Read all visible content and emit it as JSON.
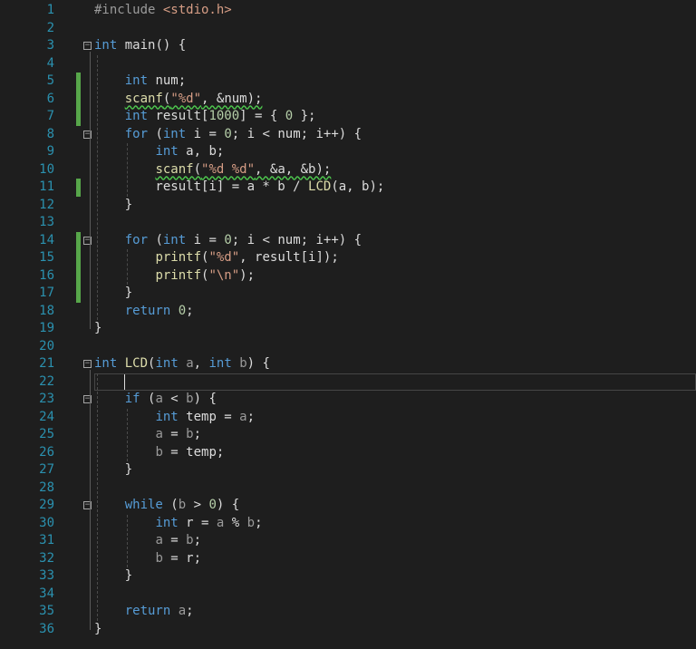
{
  "editor": {
    "lines": [
      {
        "n": "1",
        "tokens": [
          [
            "pp",
            "#include "
          ],
          [
            "str",
            "<stdio.h>"
          ]
        ]
      },
      {
        "n": "2",
        "tokens": []
      },
      {
        "n": "3",
        "tokens": [
          [
            "kw",
            "int"
          ],
          [
            "plain",
            " main() {"
          ]
        ]
      },
      {
        "n": "4",
        "tokens": []
      },
      {
        "n": "5",
        "tokens": [
          [
            "plain",
            "    "
          ],
          [
            "kw",
            "int"
          ],
          [
            "plain",
            " num;"
          ]
        ]
      },
      {
        "n": "6",
        "tokens": [
          [
            "plain",
            "    "
          ],
          [
            "fn",
            "scanf"
          ],
          [
            "plain",
            "("
          ],
          [
            "str",
            "\"%d\""
          ],
          [
            "plain",
            ", &num);"
          ]
        ]
      },
      {
        "n": "7",
        "tokens": [
          [
            "plain",
            "    "
          ],
          [
            "kw",
            "int"
          ],
          [
            "plain",
            " result["
          ],
          [
            "num",
            "1000"
          ],
          [
            "plain",
            "] = { "
          ],
          [
            "num",
            "0"
          ],
          [
            "plain",
            " };"
          ]
        ]
      },
      {
        "n": "8",
        "tokens": [
          [
            "plain",
            "    "
          ],
          [
            "kw",
            "for"
          ],
          [
            "plain",
            " ("
          ],
          [
            "kw",
            "int"
          ],
          [
            "plain",
            " i = "
          ],
          [
            "num",
            "0"
          ],
          [
            "plain",
            "; i < num; i++) {"
          ]
        ]
      },
      {
        "n": "9",
        "tokens": [
          [
            "plain",
            "        "
          ],
          [
            "kw",
            "int"
          ],
          [
            "plain",
            " a, b;"
          ]
        ]
      },
      {
        "n": "10",
        "tokens": [
          [
            "plain",
            "        "
          ],
          [
            "fn",
            "scanf"
          ],
          [
            "plain",
            "("
          ],
          [
            "str",
            "\"%d %d\""
          ],
          [
            "plain",
            ", &a, &b);"
          ]
        ]
      },
      {
        "n": "11",
        "tokens": [
          [
            "plain",
            "        result[i] = a * b / "
          ],
          [
            "fn",
            "LCD"
          ],
          [
            "plain",
            "(a, b);"
          ]
        ]
      },
      {
        "n": "12",
        "tokens": [
          [
            "plain",
            "    }"
          ]
        ]
      },
      {
        "n": "13",
        "tokens": []
      },
      {
        "n": "14",
        "tokens": [
          [
            "plain",
            "    "
          ],
          [
            "kw",
            "for"
          ],
          [
            "plain",
            " ("
          ],
          [
            "kw",
            "int"
          ],
          [
            "plain",
            " i = "
          ],
          [
            "num",
            "0"
          ],
          [
            "plain",
            "; i < num; i++) {"
          ]
        ]
      },
      {
        "n": "15",
        "tokens": [
          [
            "plain",
            "        "
          ],
          [
            "fn",
            "printf"
          ],
          [
            "plain",
            "("
          ],
          [
            "str",
            "\"%d\""
          ],
          [
            "plain",
            ", result[i]);"
          ]
        ]
      },
      {
        "n": "16",
        "tokens": [
          [
            "plain",
            "        "
          ],
          [
            "fn",
            "printf"
          ],
          [
            "plain",
            "("
          ],
          [
            "str",
            "\"\\n\""
          ],
          [
            "plain",
            ");"
          ]
        ]
      },
      {
        "n": "17",
        "tokens": [
          [
            "plain",
            "    }"
          ]
        ]
      },
      {
        "n": "18",
        "tokens": [
          [
            "plain",
            "    "
          ],
          [
            "kw",
            "return"
          ],
          [
            "plain",
            " "
          ],
          [
            "num",
            "0"
          ],
          [
            "plain",
            ";"
          ]
        ]
      },
      {
        "n": "19",
        "tokens": [
          [
            "plain",
            "}"
          ]
        ]
      },
      {
        "n": "20",
        "tokens": []
      },
      {
        "n": "21",
        "tokens": [
          [
            "kw",
            "int"
          ],
          [
            "plain",
            " "
          ],
          [
            "fn",
            "LCD"
          ],
          [
            "plain",
            "("
          ],
          [
            "kw",
            "int"
          ],
          [
            "param",
            " a"
          ],
          [
            "plain",
            ", "
          ],
          [
            "kw",
            "int"
          ],
          [
            "param",
            " b"
          ],
          [
            "plain",
            ") {"
          ]
        ]
      },
      {
        "n": "22",
        "tokens": []
      },
      {
        "n": "23",
        "tokens": [
          [
            "plain",
            "    "
          ],
          [
            "kw",
            "if"
          ],
          [
            "plain",
            " ("
          ],
          [
            "param",
            "a"
          ],
          [
            "plain",
            " < "
          ],
          [
            "param",
            "b"
          ],
          [
            "plain",
            ") {"
          ]
        ]
      },
      {
        "n": "24",
        "tokens": [
          [
            "plain",
            "        "
          ],
          [
            "kw",
            "int"
          ],
          [
            "plain",
            " temp = "
          ],
          [
            "param",
            "a"
          ],
          [
            "plain",
            ";"
          ]
        ]
      },
      {
        "n": "25",
        "tokens": [
          [
            "plain",
            "        "
          ],
          [
            "param",
            "a"
          ],
          [
            "plain",
            " = "
          ],
          [
            "param",
            "b"
          ],
          [
            "plain",
            ";"
          ]
        ]
      },
      {
        "n": "26",
        "tokens": [
          [
            "plain",
            "        "
          ],
          [
            "param",
            "b"
          ],
          [
            "plain",
            " = temp;"
          ]
        ]
      },
      {
        "n": "27",
        "tokens": [
          [
            "plain",
            "    }"
          ]
        ]
      },
      {
        "n": "28",
        "tokens": []
      },
      {
        "n": "29",
        "tokens": [
          [
            "plain",
            "    "
          ],
          [
            "kw",
            "while"
          ],
          [
            "plain",
            " ("
          ],
          [
            "param",
            "b"
          ],
          [
            "plain",
            " > "
          ],
          [
            "num",
            "0"
          ],
          [
            "plain",
            ") {"
          ]
        ]
      },
      {
        "n": "30",
        "tokens": [
          [
            "plain",
            "        "
          ],
          [
            "kw",
            "int"
          ],
          [
            "plain",
            " r = "
          ],
          [
            "param",
            "a"
          ],
          [
            "plain",
            " % "
          ],
          [
            "param",
            "b"
          ],
          [
            "plain",
            ";"
          ]
        ]
      },
      {
        "n": "31",
        "tokens": [
          [
            "plain",
            "        "
          ],
          [
            "param",
            "a"
          ],
          [
            "plain",
            " = "
          ],
          [
            "param",
            "b"
          ],
          [
            "plain",
            ";"
          ]
        ]
      },
      {
        "n": "32",
        "tokens": [
          [
            "plain",
            "        "
          ],
          [
            "param",
            "b"
          ],
          [
            "plain",
            " = r;"
          ]
        ]
      },
      {
        "n": "33",
        "tokens": [
          [
            "plain",
            "    }"
          ]
        ]
      },
      {
        "n": "34",
        "tokens": []
      },
      {
        "n": "35",
        "tokens": [
          [
            "plain",
            "    "
          ],
          [
            "kw",
            "return"
          ],
          [
            "plain",
            " "
          ],
          [
            "param",
            "a"
          ],
          [
            "plain",
            ";"
          ]
        ]
      },
      {
        "n": "36",
        "tokens": [
          [
            "plain",
            "}"
          ]
        ]
      }
    ],
    "fold_lines": [
      "3",
      "8",
      "14",
      "21",
      "23",
      "29"
    ],
    "changed_lines": [
      "5",
      "6",
      "7",
      "11",
      "14",
      "15",
      "16",
      "17"
    ],
    "squiggle_lines": [
      "6",
      "10"
    ],
    "current_line": "22",
    "colors": {
      "background": "#1e1e1e",
      "line_number": "#2b91af",
      "keyword": "#569cd6",
      "string": "#d69d85",
      "number": "#b5cea8",
      "change_bar": "#57a64a"
    }
  }
}
